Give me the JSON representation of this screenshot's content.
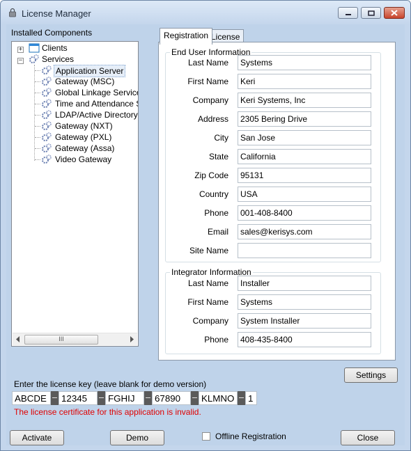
{
  "window": {
    "title": "License Manager",
    "controls": {
      "minimize": "minimize-icon",
      "maximize": "maximize-icon",
      "close": "close-icon"
    }
  },
  "tree": {
    "label": "Installed Components",
    "nodes": [
      {
        "label": "Clients",
        "expander": "+"
      },
      {
        "label": "Services",
        "expander": "−"
      }
    ],
    "services": [
      "Application Server",
      "Gateway (MSC)",
      "Global Linkage Service",
      "Time and Attendance Se",
      "LDAP/Active Directory S",
      "Gateway (NXT)",
      "Gateway (PXL)",
      "Gateway (Assa)",
      "Video Gateway"
    ],
    "selected": "Application Server",
    "scroll_grip": "III"
  },
  "tabs": [
    {
      "label": "Registration",
      "active": true
    },
    {
      "label": "License",
      "active": false
    }
  ],
  "end_user": {
    "title": "End User Information",
    "fields": [
      {
        "label": "Last Name",
        "value": "Systems"
      },
      {
        "label": "First Name",
        "value": "Keri"
      },
      {
        "label": "Company",
        "value": "Keri Systems, Inc"
      },
      {
        "label": "Address",
        "value": "2305 Bering Drive"
      },
      {
        "label": "City",
        "value": "San Jose"
      },
      {
        "label": "State",
        "value": "California"
      },
      {
        "label": "Zip Code",
        "value": "95131"
      },
      {
        "label": "Country",
        "value": "USA"
      },
      {
        "label": "Phone",
        "value": "001-408-8400"
      },
      {
        "label": "Email",
        "value": "sales@kerisys.com"
      },
      {
        "label": "Site Name",
        "value": ""
      }
    ]
  },
  "integrator": {
    "title": "Integrator Information",
    "fields": [
      {
        "label": "Last Name",
        "value": "Installer"
      },
      {
        "label": "First Name",
        "value": "Systems"
      },
      {
        "label": "Company",
        "value": "System Installer"
      },
      {
        "label": "Phone",
        "value": "408-435-8400"
      }
    ]
  },
  "settings_label": "Settings",
  "license_key": {
    "prompt": "Enter the  license key (leave blank for demo version)",
    "parts": [
      "ABCDE",
      "12345",
      "FGHIJ",
      "67890",
      "KLMNO",
      "1"
    ],
    "error": "The license certificate for this application is invalid."
  },
  "footer": {
    "activate": "Activate",
    "demo": "Demo",
    "offline": "Offline Registration",
    "offline_checked": false,
    "close": "Close"
  },
  "colors": {
    "error": "#e00000",
    "window_bg": "#bfd3ea"
  }
}
